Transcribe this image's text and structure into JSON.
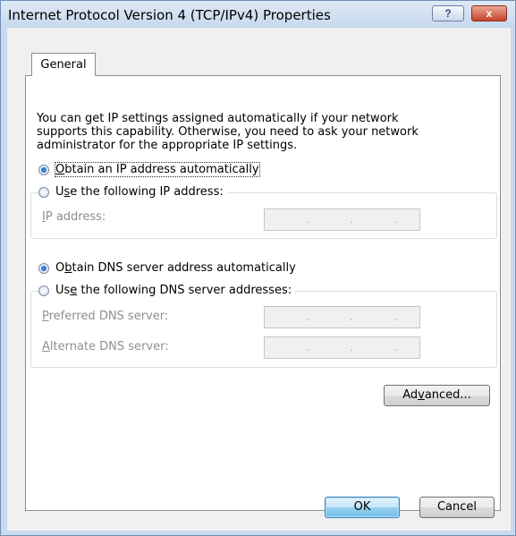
{
  "window": {
    "title": "Internet Protocol Version 4 (TCP/IPv4) Properties",
    "help_label": "?",
    "close_label": "x"
  },
  "tab": {
    "label": "General"
  },
  "intro": [
    "You can get IP settings assigned automatically if your network",
    "supports this capability. Otherwise, you need to ask your network",
    "administrator for the appropriate IP settings."
  ],
  "ip": {
    "auto": {
      "pre": "",
      "key": "O",
      "post": "btain an IP address automatically",
      "selected": true
    },
    "manual": {
      "pre": "U",
      "key": "s",
      "post": "e the following IP address:",
      "selected": false
    },
    "address": {
      "key": "I",
      "post": "P address:",
      "value": ". . ."
    }
  },
  "dns": {
    "auto": {
      "pre": "O",
      "key": "b",
      "post": "tain DNS server address automatically",
      "selected": true
    },
    "manual": {
      "pre": "Us",
      "key": "e",
      "post": " the following DNS server addresses:",
      "selected": false
    },
    "preferred": {
      "key": "P",
      "post": "referred DNS server:",
      "value": ". . ."
    },
    "alternate": {
      "key": "A",
      "post": "lternate DNS server:",
      "value": ". . ."
    }
  },
  "buttons": {
    "advanced": {
      "pre": "Ad",
      "key": "v",
      "post": "anced..."
    },
    "ok": "OK",
    "cancel": "Cancel"
  }
}
